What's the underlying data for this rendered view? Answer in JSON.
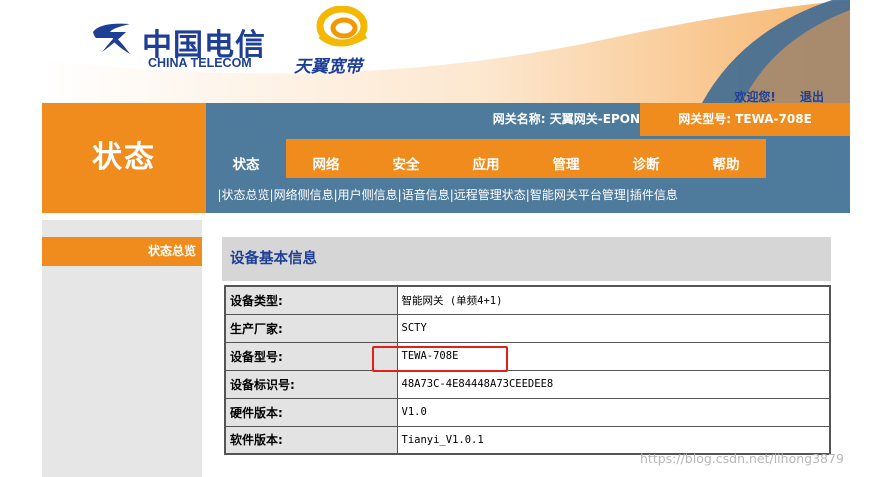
{
  "header": {
    "logo_cn": "中国电信",
    "logo_en": "CHINA TELECOM",
    "brand2": "天翼宽带",
    "welcome": "欢迎您!",
    "logout": "退出"
  },
  "infobar": {
    "gateway_name": "网关名称:  天翼网关-EPON",
    "gateway_model": "网关型号:  TEWA-708E"
  },
  "section_title": "状态",
  "tabs": [
    "状态",
    "网络",
    "安全",
    "应用",
    "管理",
    "诊断",
    "帮助"
  ],
  "subnav": [
    "状态总览",
    "网络侧信息",
    "用户侧信息",
    "语音信息",
    "远程管理状态",
    "智能网关平台管理",
    "插件信息"
  ],
  "sidebar": {
    "active_item": "状态总览"
  },
  "panel": {
    "title": "设备基本信息",
    "rows": [
      {
        "label": "设备类型:",
        "value": "智能网关 (单频4+1)"
      },
      {
        "label": "生产厂家:",
        "value": "SCTY"
      },
      {
        "label": "设备型号:",
        "value": "TEWA-708E"
      },
      {
        "label": "设备标识号:",
        "value": "48A73C-4E84448A73CEEDEE8"
      },
      {
        "label": "硬件版本:",
        "value": "V1.0"
      },
      {
        "label": "软件版本:",
        "value": "Tianyi_V1.0.1"
      }
    ]
  },
  "watermark": "https://blog.csdn.net/lihong3879",
  "colors": {
    "orange": "#f08b1d",
    "steel_blue": "#4e7a9c",
    "brand_blue": "#1f3f95",
    "highlight_red": "#e0201b"
  }
}
